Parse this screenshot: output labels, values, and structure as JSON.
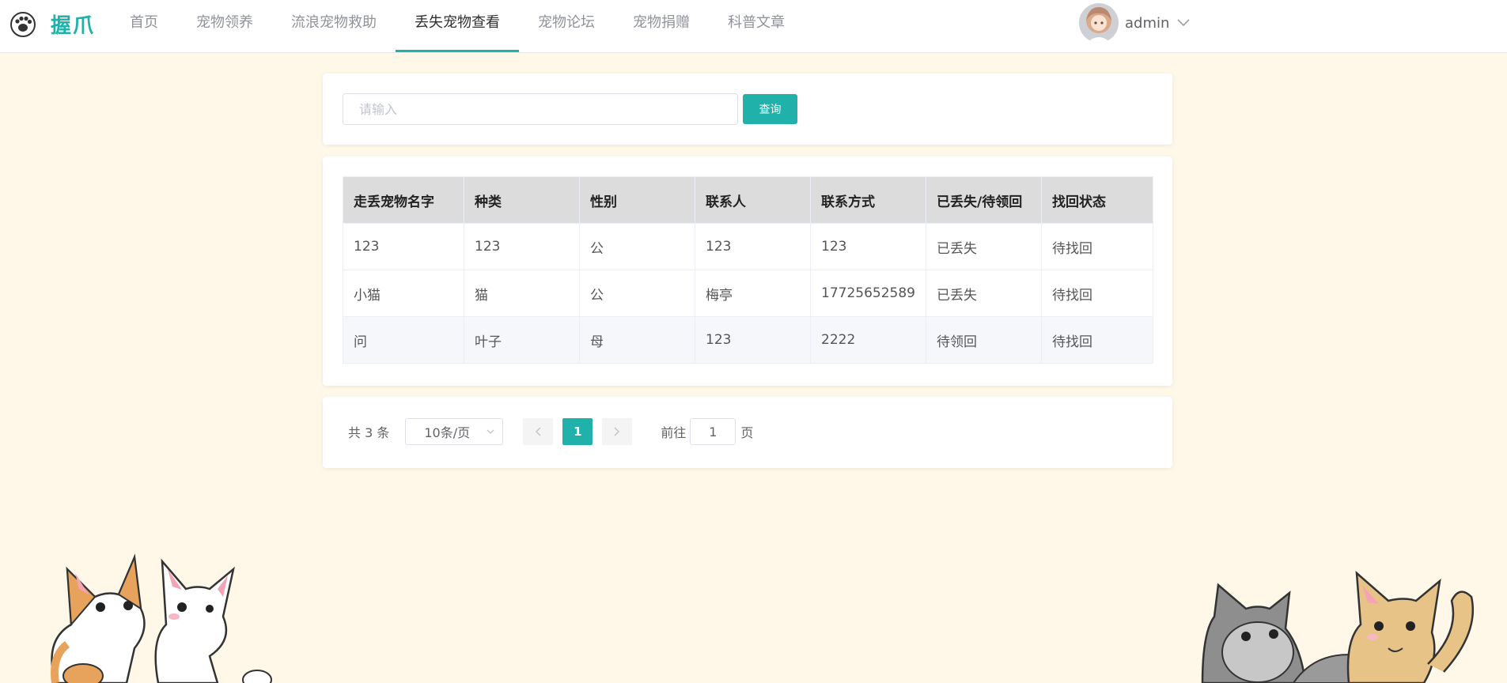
{
  "app": {
    "logo_text": "握爪",
    "logo_icon": "paw-icon"
  },
  "nav": {
    "items": [
      {
        "label": "首页"
      },
      {
        "label": "宠物领养"
      },
      {
        "label": "流浪宠物救助"
      },
      {
        "label": "丢失宠物查看",
        "active": true
      },
      {
        "label": "宠物论坛"
      },
      {
        "label": "宠物捐赠"
      },
      {
        "label": "科普文章"
      }
    ]
  },
  "user": {
    "name": "admin",
    "avatar_icon": "anime-avatar",
    "caret_icon": "chevron-down-icon"
  },
  "search": {
    "placeholder": "请输入",
    "value": "",
    "button_label": "查询"
  },
  "table": {
    "headers": [
      "走丢宠物名字",
      "种类",
      "性别",
      "联系人",
      "联系方式",
      "已丢失/待领回",
      "找回状态"
    ],
    "rows": [
      [
        "123",
        "123",
        "公",
        "123",
        "123",
        "已丢失",
        "待找回"
      ],
      [
        "小猫",
        "猫",
        "公",
        "梅亭",
        "17725652589",
        "已丢失",
        "待找回"
      ],
      [
        "问",
        "叶子",
        "母",
        "123",
        "2222",
        "待领回",
        "待找回"
      ]
    ]
  },
  "pagination": {
    "total_text": "共 3 条",
    "page_size_label": "10条/页",
    "current_page": "1",
    "goto_label": "前往",
    "goto_value": "1",
    "goto_suffix": "页"
  },
  "colors": {
    "accent": "#20b2aa",
    "background": "#fff8e8",
    "header_row": "#dcdcdc"
  }
}
